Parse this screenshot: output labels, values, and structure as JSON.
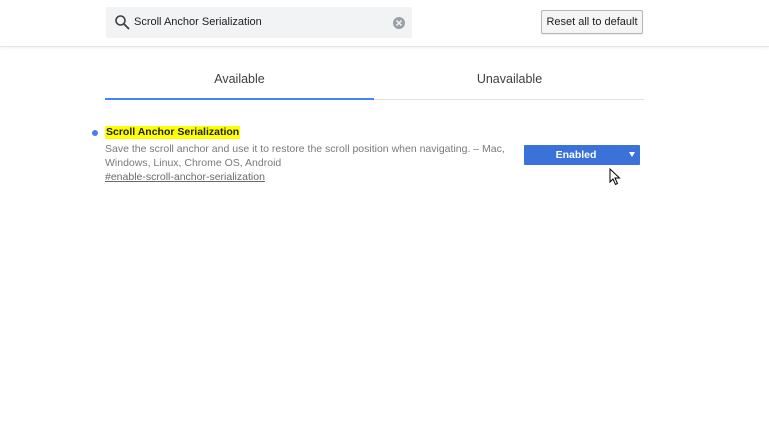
{
  "search": {
    "value": "Scroll Anchor Serialization",
    "icon": "search-icon",
    "clear_icon": "clear-icon"
  },
  "header": {
    "reset_label": "Reset all to default"
  },
  "tabs": [
    {
      "label": "Available",
      "selected": true
    },
    {
      "label": "Unavailable",
      "selected": false
    }
  ],
  "colors": {
    "accent": "#4285f4",
    "select_bg": "#3a72d9",
    "highlight": "#ffff00"
  },
  "flags": [
    {
      "title": "Scroll Anchor Serialization",
      "description": "Save the scroll anchor and use it to restore the scroll position when navigating. – Mac, Windows, Linux, Chrome OS, Android",
      "link": "#enable-scroll-anchor-serialization",
      "state": "Enabled"
    }
  ]
}
